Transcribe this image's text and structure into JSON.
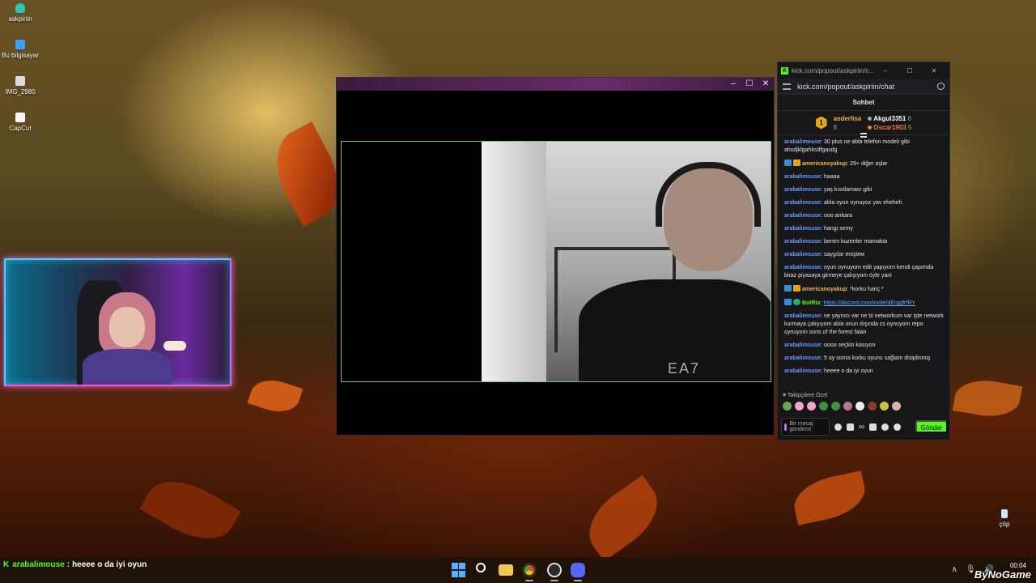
{
  "desktop": {
    "icons": [
      {
        "label": "askpiriin",
        "icon": "user-folder-icon"
      },
      {
        "label": "Bu bilgisayar",
        "icon": "computer-icon"
      },
      {
        "label": "IMG_2980",
        "icon": "image-file-icon"
      },
      {
        "label": "CapCut",
        "icon": "capcut-icon"
      },
      {
        "label": "çöp",
        "icon": "recycle-bin-icon"
      }
    ]
  },
  "call_window": {
    "controls": {
      "minimize": "–",
      "maximize": "☐",
      "close": "✕"
    },
    "shirt_logo": "EA7"
  },
  "chat": {
    "window_title": "kick.com/popout/askpiriin/c...",
    "controls": {
      "minimize": "–",
      "maximize": "☐",
      "close": "✕"
    },
    "url": "kick.com/popout/askpiriin/chat",
    "header": "Sohbet",
    "leaderboard": {
      "first": {
        "rank": "1",
        "name": "asderlisa",
        "count": "8"
      },
      "second": {
        "name": "Akgul3351",
        "count": "6"
      },
      "third": {
        "name": "Oscar1903",
        "count": "5"
      }
    },
    "messages": [
      {
        "user": "arabalimouse",
        "sep": ": ",
        "text": "30 plus ne abla telefon modeli gibi ahsdjklgahksdfgasdg"
      },
      {
        "user": "americanoyakup",
        "sep": ": ",
        "text": "29+ diğer aşlar"
      },
      {
        "user": "arabalimouse",
        "sep": ": ",
        "text": "haaaa"
      },
      {
        "user": "arabalimouse",
        "sep": ": ",
        "text": "yaş kısıtlaması gibi"
      },
      {
        "user": "arabalimouse",
        "sep": ": ",
        "text": "abla oyun oynuyoz yav eheheh"
      },
      {
        "user": "arabalimouse",
        "sep": ": ",
        "text": "ooo ankara"
      },
      {
        "user": "arabalimouse",
        "sep": ": ",
        "text": "hangi semy"
      },
      {
        "user": "arabalimouse",
        "sep": ": ",
        "text": "benim kuzenler mamakta"
      },
      {
        "user": "arabalimouse",
        "sep": ": ",
        "text": "saygılar enişteм"
      },
      {
        "user": "arabalimouse",
        "sep": ": ",
        "text": "oyun oynuyorn edit yapıyorn kendi çapımda biraz piyasaya girmeye çalışıyom öyle yani"
      },
      {
        "user": "americanoyakup",
        "sep": ": ",
        "text": "*korku hariç *"
      },
      {
        "user": "BotRix",
        "sep": ": ",
        "text": "https://discord.com/invite/dErggfrfRY"
      },
      {
        "user": "arabalimouse",
        "sep": ": ",
        "text": "ne yayıncı var ne bi networkum var işte network kurmaya çalışıyom abla onun dışında cs oynuyorn repo oynuyorn sons of the forest falan"
      },
      {
        "user": "arabalimouse",
        "sep": ": ",
        "text": "oooo seçkin kasıyon"
      },
      {
        "user": "arabalimouse",
        "sep": ": ",
        "text": "5 ay sonra korku oyunu sağlam disiplinmiş"
      },
      {
        "user": "arabalimouse",
        "sep": ": ",
        "text": "heeee o da iyi oyun"
      }
    ],
    "emote_label": "Takipçilere Özel",
    "input_placeholder": "Bir mesaj gönderin",
    "infinity": "∞",
    "send_label": "Gönder"
  },
  "taskbar": {
    "kick_ticker": {
      "user": "arabalimouse",
      "sep": ":",
      "text": "heeee o da iyi oyun"
    },
    "apps": [
      "start-icon",
      "search-icon",
      "file-explorer-icon",
      "chrome-icon",
      "obs-icon",
      "discord-icon"
    ],
    "tray": {
      "chevron": "∧",
      "mic": "🎙",
      "speaker": "🔊"
    },
    "time": "00:04",
    "watermark": "ByNoGame"
  },
  "colors": {
    "kick_green": "#53fc18",
    "username_blue": "#6a9cff",
    "gold": "#f0b84a"
  }
}
